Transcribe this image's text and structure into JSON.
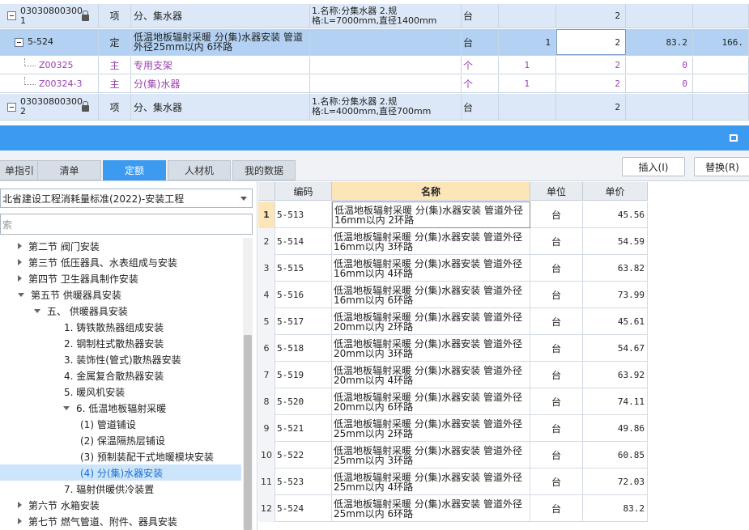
{
  "top_grid": {
    "rows": [
      {
        "kind": "section",
        "code": "03030800300 1",
        "type": "项",
        "name": "分、集水器",
        "feature": "1.名称:分集水器 2.规格:L=7000mm,直径1400mm",
        "unit": "台",
        "qty_a": "",
        "qty_b": "2",
        "price": "",
        "total": ""
      },
      {
        "kind": "selected",
        "code": "5-524",
        "type": "定",
        "name": "低温地板辐射采暖 分(集)水器安装 管道外径25mm以内 6环路",
        "feature": "",
        "unit": "台",
        "qty_a": "1",
        "qty_b": "2",
        "price": "83.2",
        "total": "166."
      },
      {
        "kind": "sub",
        "code": "Z00325",
        "type": "主",
        "name": "专用支架",
        "feature": "",
        "unit": "个",
        "qty_a": "1",
        "qty_b": "2",
        "price": "0",
        "total": ""
      },
      {
        "kind": "sub",
        "code": "Z00324-3",
        "type": "主",
        "name": "分(集)水器",
        "feature": "",
        "unit": "个",
        "qty_a": "1",
        "qty_b": "2",
        "price": "0",
        "total": ""
      },
      {
        "kind": "section",
        "code": "03030800300 2",
        "type": "项",
        "name": "分、集水器",
        "feature": "1.名称:分集水器 2.规格:L=4000mm,直径700mm",
        "unit": "台",
        "qty_a": "",
        "qty_b": "2",
        "price": "",
        "total": ""
      }
    ]
  },
  "tabs": [
    "单指引",
    "清单",
    "定额",
    "人材机",
    "我的数据"
  ],
  "active_tab": "定额",
  "buttons": {
    "insert": "插入(I)",
    "replace": "替换(R)"
  },
  "left": {
    "standard": "北省建设工程消耗量标准(2022)-安装工程",
    "search_placeholder": "索"
  },
  "tree": [
    {
      "label": "第二节 阀门安装",
      "arrow": "right",
      "level": 0,
      "selected": false
    },
    {
      "label": "第三节 低压器具、水表组成与安装",
      "arrow": "right",
      "level": 0,
      "selected": false
    },
    {
      "label": "第四节 卫生器具制作安装",
      "arrow": "right",
      "level": 0,
      "selected": false
    },
    {
      "label": "第五节 供暖器具安装",
      "arrow": "down",
      "level": 0,
      "selected": false
    },
    {
      "label": "五、 供暖器具安装",
      "arrow": "down",
      "level": 1,
      "selected": false
    },
    {
      "label": "1. 铸铁散热器组成安装",
      "arrow": "none",
      "level": 2,
      "selected": false
    },
    {
      "label": "2. 钢制柱式散热器安装",
      "arrow": "none",
      "level": 2,
      "selected": false
    },
    {
      "label": "3. 装饰性(管式)散热器安装",
      "arrow": "none",
      "level": 2,
      "selected": false
    },
    {
      "label": "4. 金属复合散热器安装",
      "arrow": "none",
      "level": 2,
      "selected": false
    },
    {
      "label": "5. 暖风机安装",
      "arrow": "none",
      "level": 2,
      "selected": false
    },
    {
      "label": "6. 低温地板辐射采暖",
      "arrow": "down",
      "level": 2,
      "selected": false
    },
    {
      "label": "(1) 管道铺设",
      "arrow": "none",
      "level": 3,
      "selected": false
    },
    {
      "label": "(2) 保温隔热层铺设",
      "arrow": "none",
      "level": 3,
      "selected": false
    },
    {
      "label": "(3) 预制装配干式地暖模块安装",
      "arrow": "none",
      "level": 3,
      "selected": false
    },
    {
      "label": "(4) 分(集)水器安装",
      "arrow": "none",
      "level": 3,
      "selected": true
    },
    {
      "label": "7. 辐射供暖供冷装置",
      "arrow": "none",
      "level": 2,
      "selected": false
    },
    {
      "label": "第六节 水箱安装",
      "arrow": "right",
      "level": 0,
      "selected": false
    },
    {
      "label": "第七节 燃气管道、附件、器具安装",
      "arrow": "right",
      "level": 0,
      "selected": false
    }
  ],
  "table": {
    "headers": {
      "code": "编码",
      "name": "名称",
      "unit": "单位",
      "price": "单价"
    },
    "rows": [
      {
        "idx": "1",
        "code": "5-513",
        "name": "低温地板辐射采暖 分(集)水器安装 管道外径16mm以内 2环路",
        "unit": "台",
        "price": "45.56"
      },
      {
        "idx": "2",
        "code": "5-514",
        "name": "低温地板辐射采暖 分(集)水器安装 管道外径16mm以内 3环路",
        "unit": "台",
        "price": "54.59"
      },
      {
        "idx": "3",
        "code": "5-515",
        "name": "低温地板辐射采暖 分(集)水器安装 管道外径16mm以内 4环路",
        "unit": "台",
        "price": "63.82"
      },
      {
        "idx": "4",
        "code": "5-516",
        "name": "低温地板辐射采暖 分(集)水器安装 管道外径16mm以内 6环路",
        "unit": "台",
        "price": "73.99"
      },
      {
        "idx": "5",
        "code": "5-517",
        "name": "低温地板辐射采暖 分(集)水器安装 管道外径20mm以内 2环路",
        "unit": "台",
        "price": "45.61"
      },
      {
        "idx": "6",
        "code": "5-518",
        "name": "低温地板辐射采暖 分(集)水器安装 管道外径20mm以内 3环路",
        "unit": "台",
        "price": "54.67"
      },
      {
        "idx": "7",
        "code": "5-519",
        "name": "低温地板辐射采暖 分(集)水器安装 管道外径20mm以内 4环路",
        "unit": "台",
        "price": "63.92"
      },
      {
        "idx": "8",
        "code": "5-520",
        "name": "低温地板辐射采暖 分(集)水器安装 管道外径20mm以内 6环路",
        "unit": "台",
        "price": "74.11"
      },
      {
        "idx": "9",
        "code": "5-521",
        "name": "低温地板辐射采暖 分(集)水器安装 管道外径25mm以内 2环路",
        "unit": "台",
        "price": "49.86"
      },
      {
        "idx": "10",
        "code": "5-522",
        "name": "低温地板辐射采暖 分(集)水器安装 管道外径25mm以内 3环路",
        "unit": "台",
        "price": "60.85"
      },
      {
        "idx": "11",
        "code": "5-523",
        "name": "低温地板辐射采暖 分(集)水器安装 管道外径25mm以内 4环路",
        "unit": "台",
        "price": "72.03"
      },
      {
        "idx": "12",
        "code": "5-524",
        "name": "低温地板辐射采暖 分(集)水器安装 管道外径25mm以内 6环路",
        "unit": "台",
        "price": "83.2"
      }
    ]
  },
  "colors": {
    "accent": "#3c9bf0",
    "selected_row": "#b3d2f3",
    "section_row": "#dce8f7",
    "material_text": "#9b3fb0",
    "header_highlight": "#fce6b9"
  },
  "icons": {
    "expander": "collapse-square-icon",
    "lock": "lock-icon",
    "restore": "window-restore-icon",
    "dropdown": "chevron-down-icon"
  }
}
